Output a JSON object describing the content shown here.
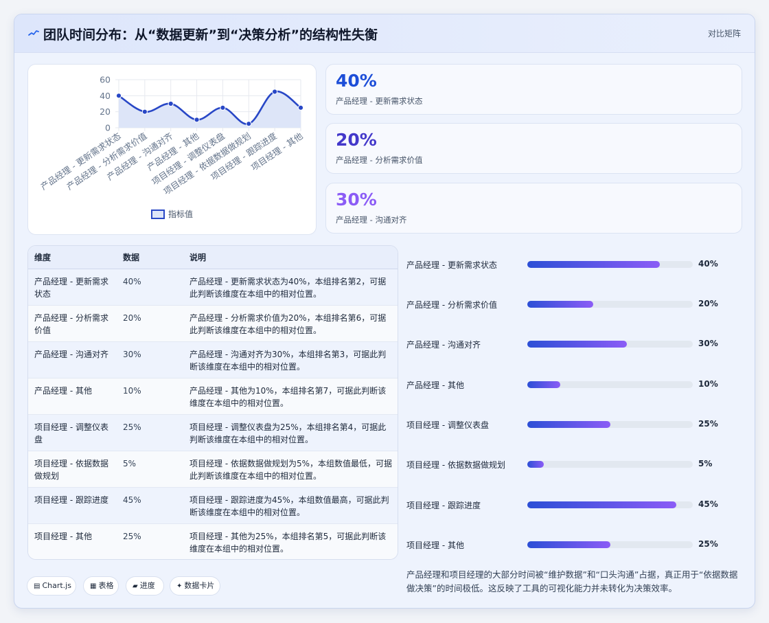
{
  "header": {
    "title": "团队时间分布：从“数据更新”到“决策分析”的结构性失衡",
    "view_button": "对比矩阵",
    "icon": "sparkline-icon"
  },
  "chart_data": {
    "type": "line",
    "categories": [
      "产品经理 - 更新需求状态",
      "产品经理 - 分析需求价值",
      "产品经理 - 沟通对齐",
      "产品经理 - 其他",
      "项目经理 - 调整仪表盘",
      "项目经理 - 依据数据做规划",
      "项目经理 - 跟踪进度",
      "项目经理 - 其他"
    ],
    "series": [
      {
        "name": "指标值",
        "values": [
          40,
          20,
          30,
          10,
          25,
          5,
          45,
          25
        ]
      }
    ],
    "ylim": [
      0,
      60
    ],
    "yticks": [
      0,
      20,
      40,
      60
    ],
    "grid": true,
    "legend": "bottom",
    "colors": {
      "line": "#2847c6",
      "fill": "#dde5f8",
      "grid": "#e6e9ef",
      "tick": "#64748b"
    }
  },
  "kpis": [
    {
      "value": "40%",
      "label": "产品经理 - 更新需求状态",
      "color": "#1d4ed8"
    },
    {
      "value": "20%",
      "label": "产品经理 - 分析需求价值",
      "color": "#4338ca"
    },
    {
      "value": "30%",
      "label": "产品经理 - 沟通对齐",
      "color": "#8b5cf6"
    }
  ],
  "table": {
    "headers": [
      "维度",
      "数据",
      "说明"
    ],
    "rows": [
      [
        "产品经理 - 更新需求状态",
        "40%",
        "产品经理 - 更新需求状态为40%，本组排名第2，可据此判断该维度在本组中的相对位置。"
      ],
      [
        "产品经理 - 分析需求价值",
        "20%",
        "产品经理 - 分析需求价值为20%，本组排名第6，可据此判断该维度在本组中的相对位置。"
      ],
      [
        "产品经理 - 沟通对齐",
        "30%",
        "产品经理 - 沟通对齐为30%，本组排名第3，可据此判断该维度在本组中的相对位置。"
      ],
      [
        "产品经理 - 其他",
        "10%",
        "产品经理 - 其他为10%，本组排名第7，可据此判断该维度在本组中的相对位置。"
      ],
      [
        "项目经理 - 调整仪表盘",
        "25%",
        "项目经理 - 调整仪表盘为25%，本组排名第4，可据此判断该维度在本组中的相对位置。"
      ],
      [
        "项目经理 - 依据数据做规划",
        "5%",
        "项目经理 - 依据数据做规划为5%，本组数值最低，可据此判断该维度在本组中的相对位置。"
      ],
      [
        "项目经理 - 跟踪进度",
        "45%",
        "项目经理 - 跟踪进度为45%，本组数值最高，可据此判断该维度在本组中的相对位置。"
      ],
      [
        "项目经理 - 其他",
        "25%",
        "项目经理 - 其他为25%，本组排名第5，可据此判断该维度在本组中的相对位置。"
      ]
    ]
  },
  "progress": {
    "max": 50,
    "items": [
      {
        "label": "产品经理 - 更新需求状态",
        "value": 40,
        "display": "40%"
      },
      {
        "label": "产品经理 - 分析需求价值",
        "value": 20,
        "display": "20%"
      },
      {
        "label": "产品经理 - 沟通对齐",
        "value": 30,
        "display": "30%"
      },
      {
        "label": "产品经理 - 其他",
        "value": 10,
        "display": "10%"
      },
      {
        "label": "项目经理 - 调整仪表盘",
        "value": 25,
        "display": "25%"
      },
      {
        "label": "项目经理 - 依据数据做规划",
        "value": 5,
        "display": "5%"
      },
      {
        "label": "项目经理 - 跟踪进度",
        "value": 45,
        "display": "45%"
      },
      {
        "label": "项目经理 - 其他",
        "value": 25,
        "display": "25%"
      }
    ]
  },
  "summary": "产品经理和项目经理的大部分时间被“维护数据”和“口头沟通”占据，真正用于“依据数据做决策”的时间极低。这反映了工具的可视化能力并未转化为决策效率。",
  "chips": [
    {
      "icon": "chart-icon",
      "glyph": "▤",
      "label": "Chart.js"
    },
    {
      "icon": "table-icon",
      "glyph": "▦",
      "label": "表格"
    },
    {
      "icon": "progress-icon",
      "glyph": "▰",
      "label": "进度"
    },
    {
      "icon": "sparkle-icon",
      "glyph": "✦",
      "label": "数据卡片"
    }
  ]
}
